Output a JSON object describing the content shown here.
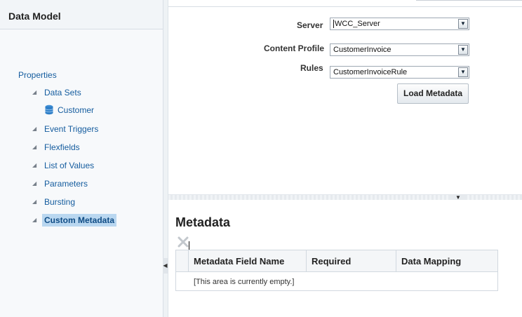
{
  "left_panel": {
    "title": "Data Model",
    "items": [
      {
        "label": "Properties"
      },
      {
        "label": "Data Sets"
      },
      {
        "label": "Customer"
      },
      {
        "label": "Event Triggers"
      },
      {
        "label": "Flexfields"
      },
      {
        "label": "List of Values"
      },
      {
        "label": "Parameters"
      },
      {
        "label": "Bursting"
      },
      {
        "label": "Custom Metadata"
      }
    ]
  },
  "form": {
    "server_label": "Server",
    "server_value": "WCC_Server",
    "content_profile_label": "Content Profile",
    "content_profile_value": "CustomerInvoice",
    "rules_label": "Rules",
    "rules_value": "CustomerInvoiceRule",
    "load_button": "Load Metadata"
  },
  "metadata": {
    "title": "Metadata",
    "columns": [
      "Metadata Field Name",
      "Required",
      "Data Mapping"
    ],
    "empty_text": "[This area is currently empty.]"
  },
  "icons": {
    "tree_expand": "triangle-down-icon",
    "dataset": "database-icon",
    "delete": "delete-x-icon",
    "dropdown": "chevron-down-icon"
  },
  "colors": {
    "link": "#145c9e",
    "selected_bg": "#b9d7f0"
  }
}
